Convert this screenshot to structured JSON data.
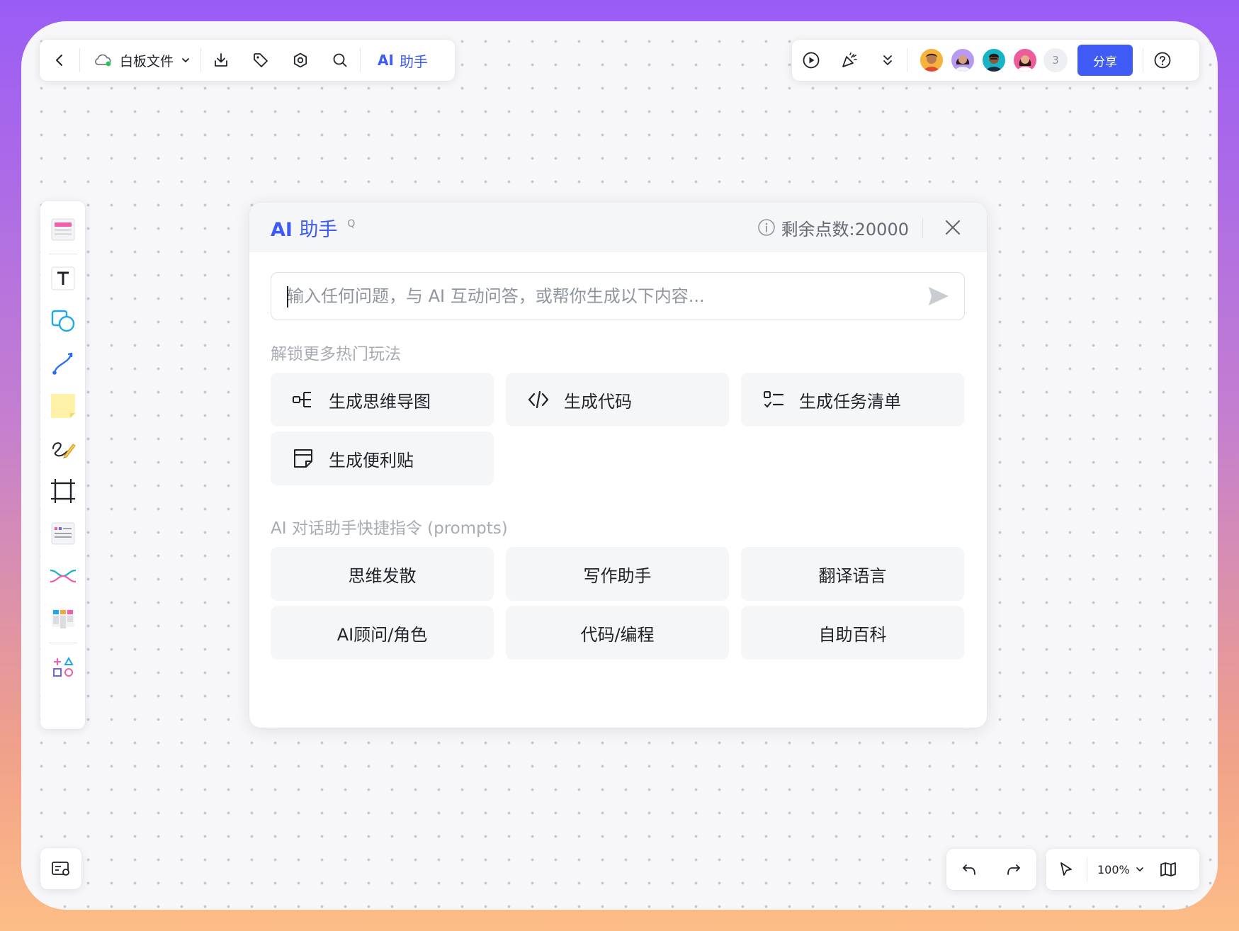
{
  "toolbar": {
    "file_name": "白板文件",
    "ai_label_latin": "AI",
    "ai_label_zh": "助手"
  },
  "collab": {
    "extra_count": "3",
    "share_label": "分享"
  },
  "zoom": {
    "value": "100%"
  },
  "ai_panel": {
    "title_latin": "AI",
    "title_zh": "助手",
    "title_suffix": "Q",
    "credits": "剩余点数:20000",
    "input_placeholder": "输入任何问题，与 AI 互动问答，或帮你生成以下内容...",
    "section_features": "解锁更多热门玩法",
    "features": [
      {
        "label": "生成思维导图",
        "icon": "mindmap-icon"
      },
      {
        "label": "生成代码",
        "icon": "code-icon"
      },
      {
        "label": "生成任务清单",
        "icon": "checklist-icon"
      },
      {
        "label": "生成便利贴",
        "icon": "sticky-note-icon"
      }
    ],
    "section_prompts": "AI 对话助手快捷指令 (prompts)",
    "prompts": [
      "思维发散",
      "写作助手",
      "翻译语言",
      "AI顾问/角色",
      "代码/编程",
      "自助百科"
    ]
  },
  "colors": {
    "accent": "#3f5bf6",
    "sticky": "#fff2a8"
  }
}
